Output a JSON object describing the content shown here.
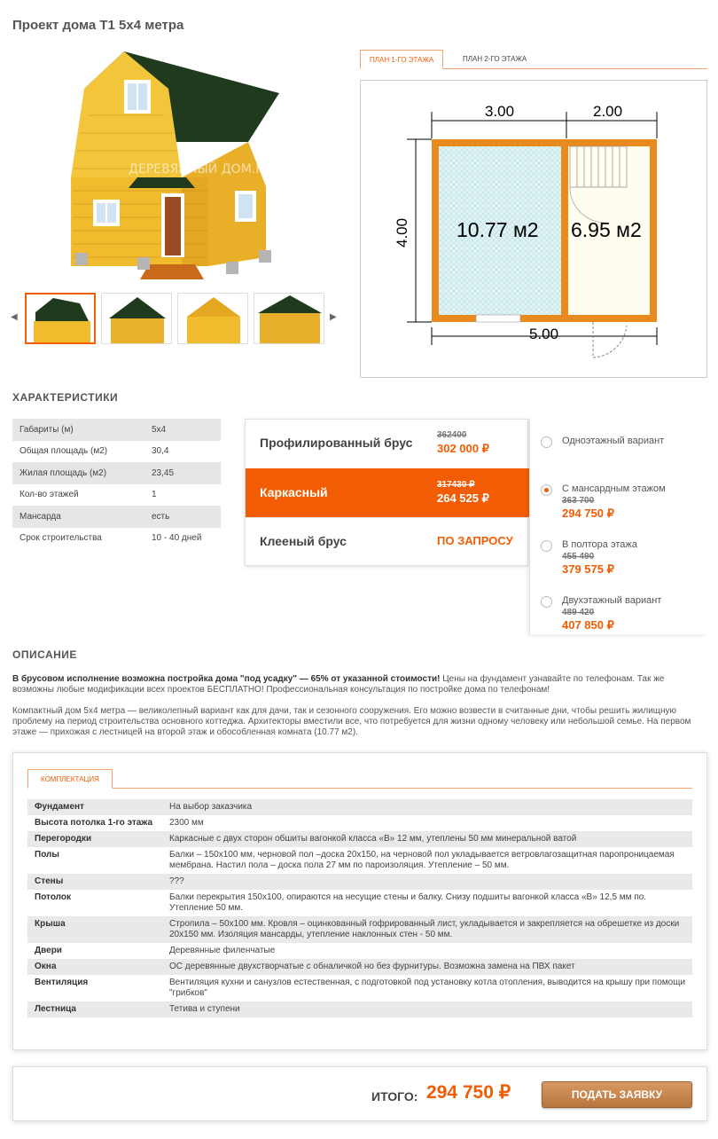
{
  "page": {
    "title": "Проект дома Т1 5х4 метра"
  },
  "gallery": {
    "watermark": "ДЕРЕВЯННЫЙ ДОМ.РУ",
    "prev": "◀",
    "next": "▶"
  },
  "plan": {
    "tabs": [
      {
        "label": "ПЛАН 1-ГО ЭТАЖА",
        "active": true
      },
      {
        "label": "ПЛАН 2-ГО ЭТАЖА",
        "active": false
      }
    ],
    "dims": {
      "top_left": "3.00",
      "top_right": "2.00",
      "bottom": "5.00",
      "side": "4.00"
    },
    "rooms": {
      "left": "10.77 м2",
      "right": "6.95 м2"
    }
  },
  "characteristics": {
    "title": "ХАРАКТЕРИСТИКИ",
    "rows": [
      {
        "k": "Габариты (м)",
        "v": "5х4"
      },
      {
        "k": "Общая площадь (м2)",
        "v": "30,4"
      },
      {
        "k": "Жилая площадь (м2)",
        "v": "23,45"
      },
      {
        "k": "Кол-во этажей",
        "v": "1"
      },
      {
        "k": "Мансарда",
        "v": "есть"
      },
      {
        "k": "Срок строительства",
        "v": "10 - 40 дней"
      }
    ]
  },
  "materials": [
    {
      "name": "Профилированный брус",
      "old": "362400",
      "price": "302 000 ₽",
      "active": false
    },
    {
      "name": "Каркасный",
      "old": "317430 ₽",
      "price": "264 525 ₽",
      "active": true
    },
    {
      "name": "Клееный брус",
      "old": "",
      "price": "ПО ЗАПРОСУ",
      "active": false
    }
  ],
  "variants": [
    {
      "label": "Одноэтажный вариант",
      "old": "",
      "price": "",
      "checked": false
    },
    {
      "label": "С мансардным этажом",
      "old": "363 700",
      "price": "294 750 ₽",
      "checked": true
    },
    {
      "label": "В полтора этажа",
      "old": "455 490",
      "price": "379 575 ₽",
      "checked": false
    },
    {
      "label": "Двухэтажный вариант",
      "old": "489 420",
      "price": "407 850 ₽",
      "checked": false
    }
  ],
  "description": {
    "title": "ОПИСАНИЕ",
    "p1_bold": "В брусовом исполнение возможна постройка дома \"под усадку\" — 65% от указанной стоимости!",
    "p1_rest": " Цены на фундамент узнавайте по телефонам. Так же возможны любые модификации всех проектов БЕСПЛАТНО! Профессиональная консультация по постройке дома по телефонам!",
    "p2": "Компактный дом 5х4 метра — великолепный вариант как для дачи, так и сезонного сооружения. Его можно возвести в считанные дни, чтобы решить жилищную проблему на период строительства основного коттеджа. Архитекторы вместили все, что потребуется для жизни одному человеку или небольшой семье. На первом этаже — прихожая с лестницей на второй этаж и обособленная комната (10.77 м2)."
  },
  "kompl": {
    "tab": "КОМПЛЕКТАЦИЯ",
    "rows": [
      {
        "k": "Фундамент",
        "v": "На выбор заказчика"
      },
      {
        "k": "Высота потолка 1-го этажа",
        "v": "2300 мм"
      },
      {
        "k": "Перегородки",
        "v": "Каркасные с двух сторон обшиты вагонкой класса «В» 12 мм, утеплены 50 мм минеральной ватой"
      },
      {
        "k": "Полы",
        "v": "Балки – 150х100 мм, черновой пол –доска 20х150, на черновой пол укладывается ветровлагозащитная паропроницаемая мембрана. Настил пола – доска пола 27 мм по пароизоляция. Утепление – 50 мм."
      },
      {
        "k": "Стены",
        "v": "???"
      },
      {
        "k": "Потолок",
        "v": "Балки перекрытия 150х100, опираются на несущие стены и балку. Снизу подшиты вагонкой класса «В» 12,5 мм по. Утепление 50 мм."
      },
      {
        "k": "Крыша",
        "v": "Стропила – 50х100 мм. Кровля – оцинкованный гофрированный лист, укладывается и закрепляется на обрешетке из доски 20х150 мм. Изоляция мансарды, утепление наклонных стен - 50 мм."
      },
      {
        "k": "Двери",
        "v": "Деревянные филенчатые"
      },
      {
        "k": "Окна",
        "v": "ОС деревянные двухстворчатые с обналичкой но без фурнитуры. Возможна замена на ПВХ пакет"
      },
      {
        "k": "Вентиляция",
        "v": "Вентиляция кухни и санузлов естественная, с подготовкой под установку котла отопления, выводится на крышу при помощи \"грибков\""
      },
      {
        "k": "Лестница",
        "v": "Тетива и ступени"
      }
    ]
  },
  "total": {
    "label": "ИТОГО:",
    "value": "294 750 ₽",
    "button": "ПОДАТЬ ЗАЯВКУ"
  },
  "colors": {
    "accent": "#f25c05",
    "roof": "#1f3a1c",
    "wood": "#f2c12e"
  }
}
